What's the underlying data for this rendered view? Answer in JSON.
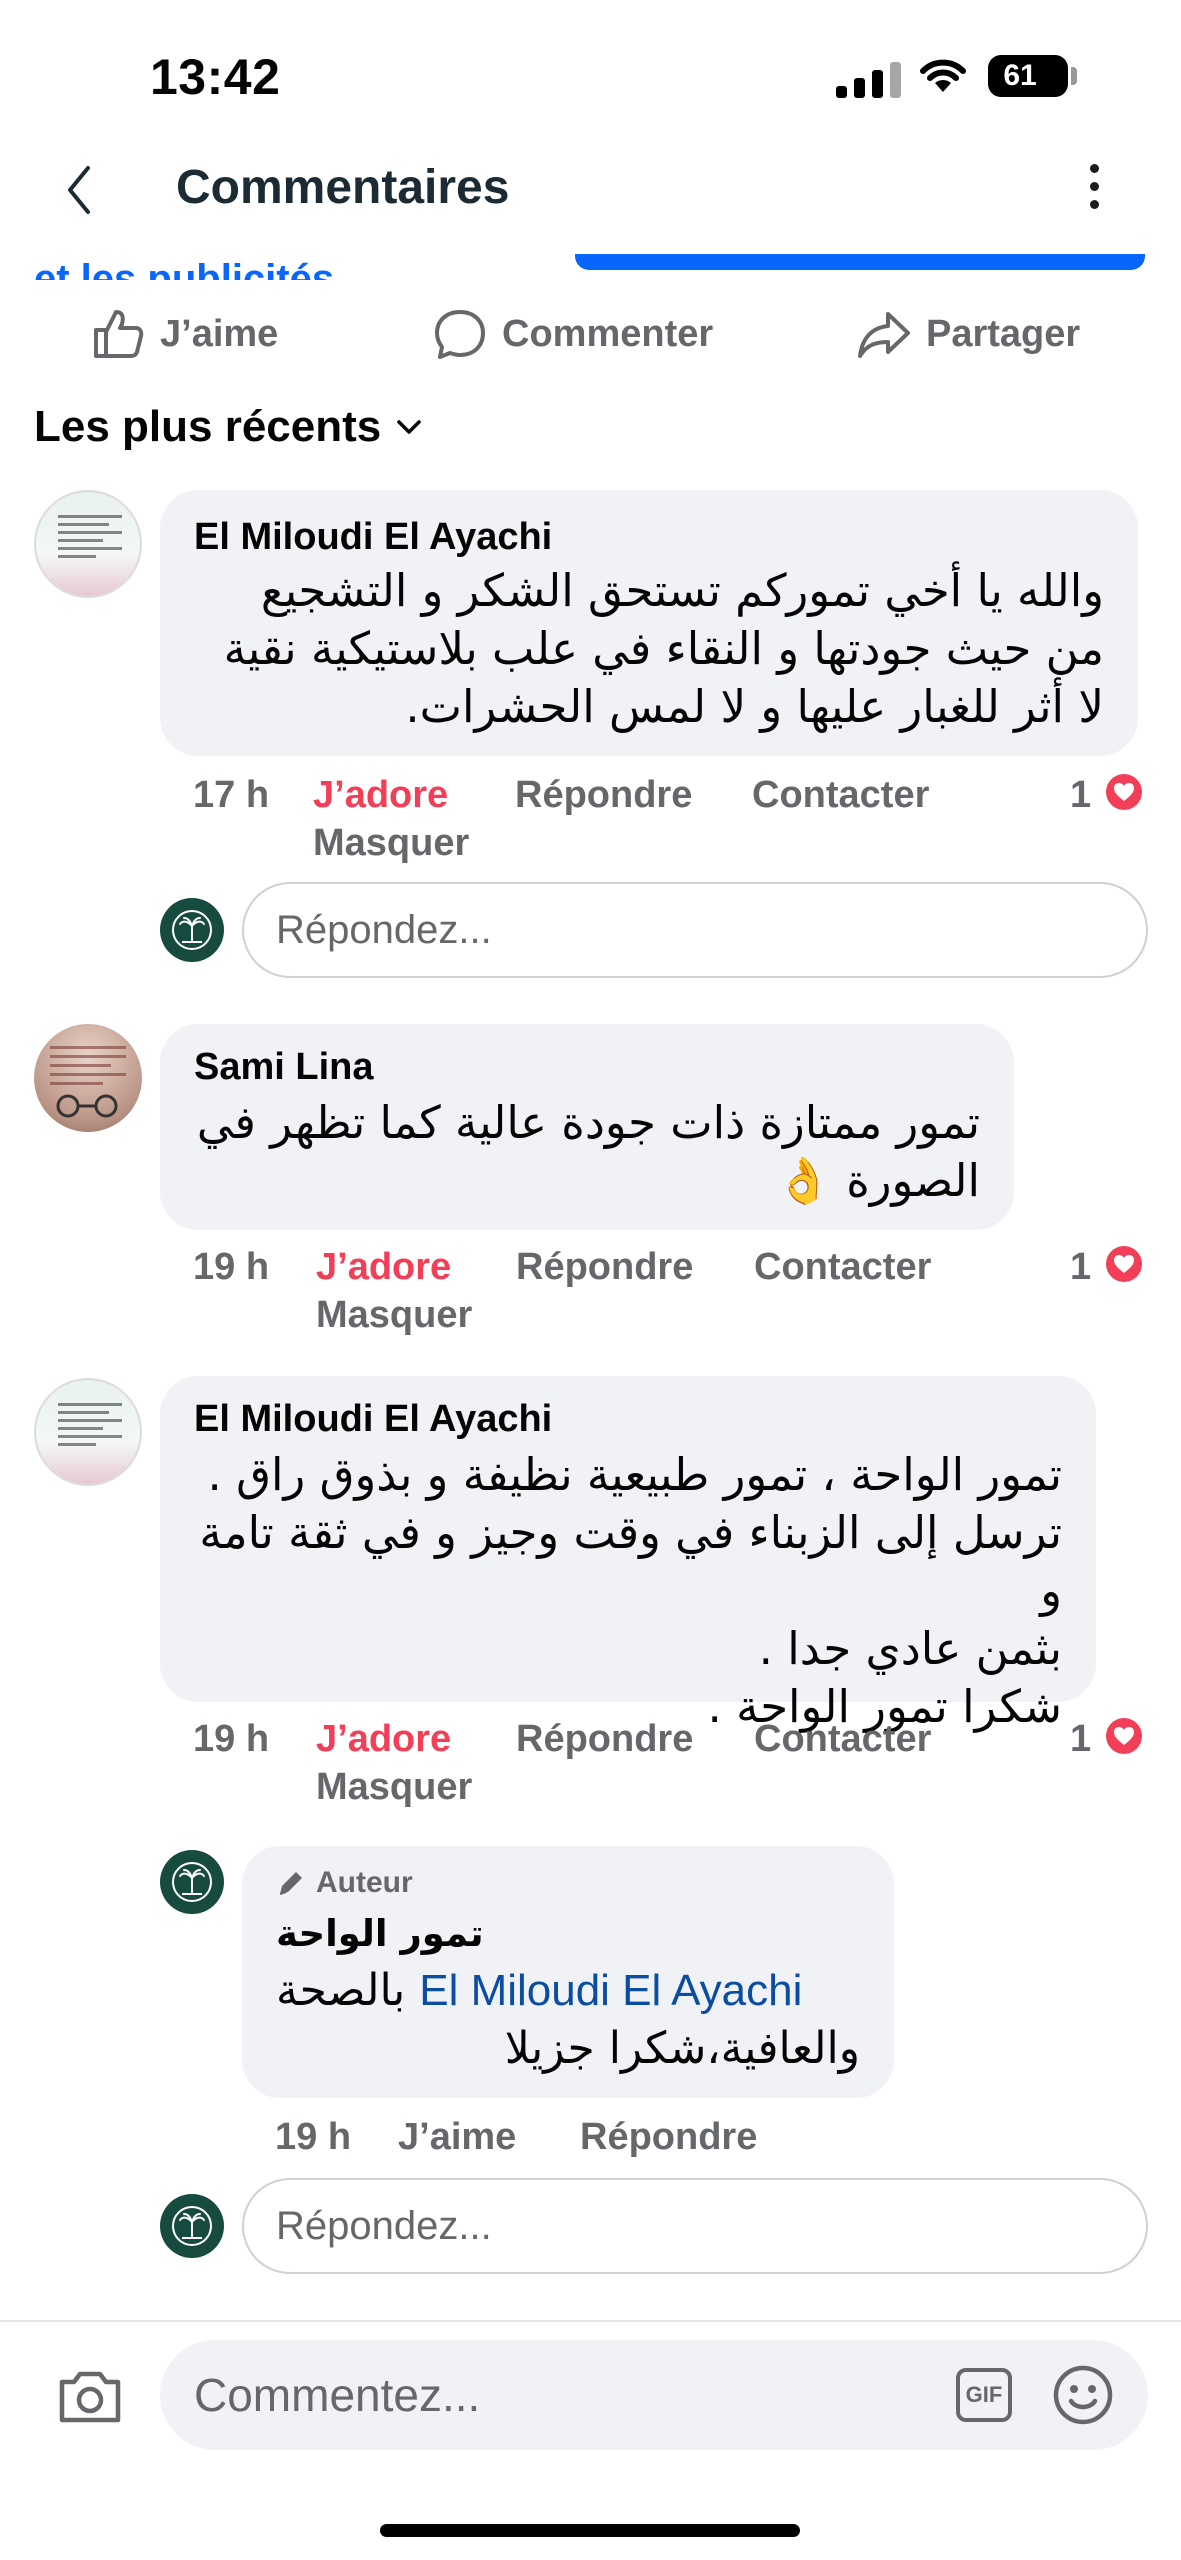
{
  "status_bar": {
    "time": "13:42",
    "battery": "61"
  },
  "header": {
    "title": "Commentaires"
  },
  "post": {
    "partial_text": "et les publicités"
  },
  "actions": {
    "like": "J’aime",
    "comment": "Commenter",
    "share": "Partager"
  },
  "sort": {
    "label": "Les plus récents"
  },
  "comments": [
    {
      "author": "El Miloudi El Ayachi",
      "lines": [
        "والله يا أخي تموركم تستحق الشكر و التشجيع",
        "من حيث جودتها و النقاء في علب بلاستيكية نقية",
        "لا أثر للغبار عليها و لا لمس الحشرات."
      ],
      "time": "17 h",
      "reaction": "J’adore",
      "reply": "Répondre",
      "contact": "Contacter",
      "hide": "Masquer",
      "count": "1"
    },
    {
      "author": "Sami Lina",
      "lines": [
        "تمور ممتازة ذات جودة عالية كما تظهر في",
        "الصورة 👌"
      ],
      "time": "19 h",
      "reaction": "J’adore",
      "reply": "Répondre",
      "contact": "Contacter",
      "hide": "Masquer",
      "count": "1"
    },
    {
      "author": "El Miloudi El Ayachi",
      "lines": [
        "تمور الواحة ، تمور طبيعية نظيفة و بذوق راق .",
        "ترسل إلى الزبناء في وقت وجيز و في ثقة تامة و",
        "بثمن عادي جدا .",
        "شكرا تمور الواحة ."
      ],
      "time": "19 h",
      "reaction": "J’adore",
      "reply": "Répondre",
      "contact": "Contacter",
      "hide": "Masquer",
      "count": "1"
    }
  ],
  "author_reply": {
    "badge": "Auteur",
    "page_name": "تمور الواحة",
    "mention": "El Miloudi El Ayachi",
    "text_after_mention": "بالصحة",
    "line2": "والعافية،شكرا جزيلا",
    "time": "19 h",
    "like": "J’aime",
    "reply": "Répondre"
  },
  "reply_placeholder": "Répondez...",
  "composer": {
    "placeholder": "Commentez...",
    "gif": "GIF"
  },
  "colors": {
    "accent": "#0866ff",
    "love": "#f33e58",
    "muted": "#65676b",
    "bubble": "#f0f2f5"
  },
  "icons": [
    "back-chevron-icon",
    "more-vertical-icon",
    "thumbs-up-icon",
    "comment-bubble-icon",
    "share-arrow-icon",
    "chevron-down-icon",
    "heart-icon",
    "pencil-icon",
    "camera-icon",
    "gif-icon",
    "smiley-icon"
  ]
}
